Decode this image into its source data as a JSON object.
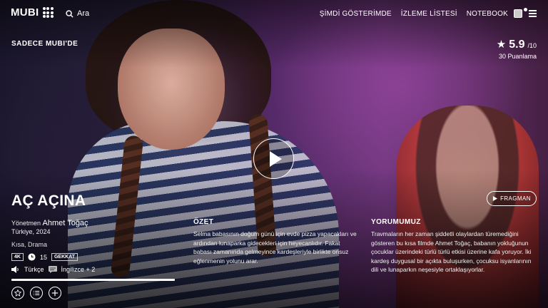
{
  "nav": {
    "logo": "MUBI",
    "search_label": "Ara",
    "menu": [
      "ŞİMDİ GÖSTERİMDE",
      "İZLEME LİSTESİ",
      "NOTEBOOK"
    ]
  },
  "film": {
    "exclusive_label": "SADECE MUBI'DE",
    "rating": {
      "score": "5.9",
      "out_of": "/10",
      "count": "30 Puanlama"
    },
    "trailer_label": "FRAGMAN",
    "title": "AÇ AÇINA",
    "director_prefix": "Yönetmen",
    "director": "Ahmet Toğaç",
    "country_year": "Türkiye, 2024",
    "genres": "Kısa, Drama",
    "quality_badge": "4K",
    "duration": "15",
    "rating_badge": "GEKKAT",
    "audio": "Türkçe",
    "subtitles": "İngilizce + 2",
    "watch_progress": 1.0
  },
  "synopsis": {
    "heading": "ÖZET",
    "text": "Selma babasının doğum günü için evde pizza yapacakları ve ardından lunaparka gidecekleri için heyecanlıdır. Fakat babası zamanında gelmeyince kardeşleriyle birlikte onsuz eğlenmenin yolunu arar."
  },
  "review": {
    "heading": "YORUMUMUZ",
    "text": "Travmaların her zaman şiddetli olaylardan türemediğini gösteren bu kısa filmde Ahmet Toğaç, babanın yokluğunun çocuklar üzerindeki türlü türlü etkisi üzerine kafa yoruyor. İki kardeş duygusal bir açıkta buluşurken, çocuksu isyanlarının dili ve lunaparkın neşesiyle ortaklaşıyorlar."
  },
  "icons": [
    "search-icon",
    "avatar-icon",
    "menu-icon",
    "star-icon",
    "play-icon",
    "clock-icon",
    "speaker-icon",
    "subtitles-icon",
    "rate-icon",
    "list-icon",
    "add-icon"
  ]
}
